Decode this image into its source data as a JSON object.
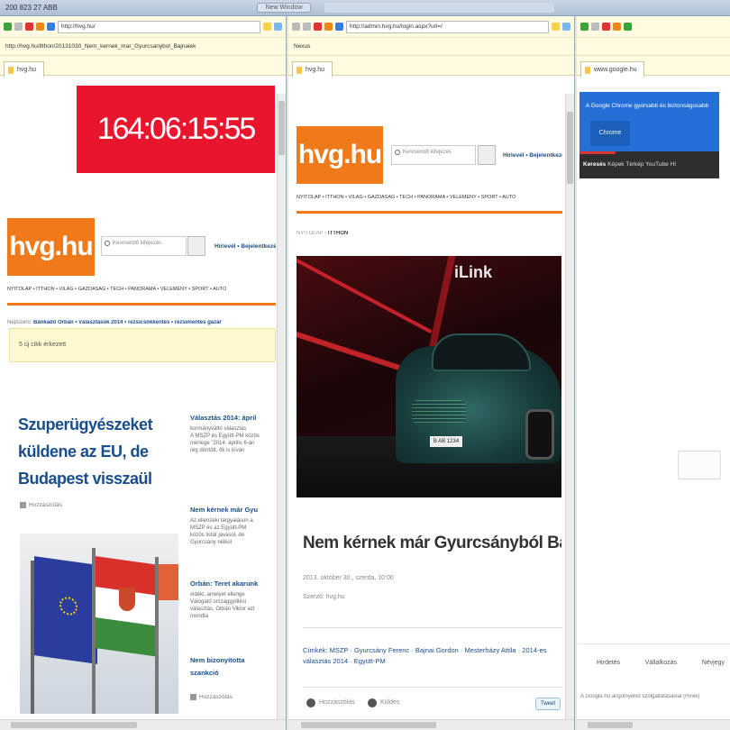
{
  "window": {
    "title": "200 823 27 ABB",
    "center_tab": "New Window"
  },
  "pane1": {
    "address": "http://hvg.hu/",
    "url": "http://hvg.hu/itthon/20131030_Nem_kernek_mar_Gyurcsanybol_Bajnaiek",
    "tab_label": "hvg.hu",
    "counter": "164:06:15:55",
    "logo": "hvg.hu",
    "search_placeholder": "Keresendő kifejezés",
    "top_links": "Hírlevél • Bejelentkezés",
    "nav": "NYITÓLAP • ITTHON • VILÁG • GAZDASÁG • TECH • PANORÁMA • VÉLEMÉNY • SPORT • AUTÓ",
    "hot_topics_label": "Népszerű:",
    "hot_topics": "Bankadó Orbán • Választások 2014 • rezsicsökkentés • rezsimentes gázár",
    "notice": "5 új cikk érkezett",
    "main_headline": "Szuperügyészeket küldene az EU, de Budapest visszaül",
    "main_meta": "Hozzászólás",
    "side_items": [
      {
        "title": "Választás 2014: ápril",
        "text": "kormányváltó választás\nA MSZP és Együtt-PM közös\nmérlege \"2014. április 6-án\nrég döntött, ők is kíván"
      },
      {
        "title": "Nem kérnek már Gyu",
        "text": "Az ellenzéki tárgyaláson a\nMSZP és az Együtt-PM\nközös listát javasol, de\nGyurcsány nélkül"
      },
      {
        "title": "Orbán: Teret akarunk",
        "text": "vidéki, amelyet ellenge\nVálogató országgyűlési\nválasztás, Orbán Viktor azt\nmondta"
      },
      {
        "title": "Nem bizonyította",
        "text": ""
      }
    ],
    "side_last_title": "szankció",
    "side_last_meta": "Hozzászólás"
  },
  "pane2": {
    "address": "http://admin.hvg.hu/login.aspx?url=/",
    "url": "Nexus",
    "tab_label": "hvg.hu",
    "logo": "hvg.hu",
    "search_placeholder": "Keresendő kifejezés",
    "top_links": "Hírlevél • Bejelentkezés",
    "nav": "NYITÓLAP • ITTHON • VILÁG • GAZDASÁG • TECH • PANORÁMA • VÉLEMÉNY • SPORT • AUTÓ",
    "breadcrumb_home": "NYITÓLAP",
    "breadcrumb_section": "ITTHON",
    "ad_text": "iLink",
    "plate": "B AB 1234",
    "article_title": "Nem kérnek már Gyurcsányból Ba",
    "article_date": "2013. október 30., szerda, 10:00",
    "article_source": "Szerző: hvg.hu",
    "related": "Címkék: MSZP · Gyurcsány Ferenc · Bajnai Gordon · Mesterházy Attila · 2014-es választás 2014 · Együtt-PM",
    "share_1": "Hozzászólás",
    "share_2": "Küldés",
    "share_button": "Tweet"
  },
  "pane3": {
    "tab_label": "www.google.hu",
    "banner_text": "A Google Chrome gyorsabb és biztonságosabb",
    "banner_button": "Chrome",
    "darkbar_label": "Keresés",
    "darkbar_links": "Képek  Térkép  YouTube  Hí",
    "footer_links": [
      "Hirdetés",
      "Vállalkozás",
      "Névjegy"
    ],
    "footnote": "A Google.hu angolnyelvű szolgáltatásaival (Hírek)"
  }
}
